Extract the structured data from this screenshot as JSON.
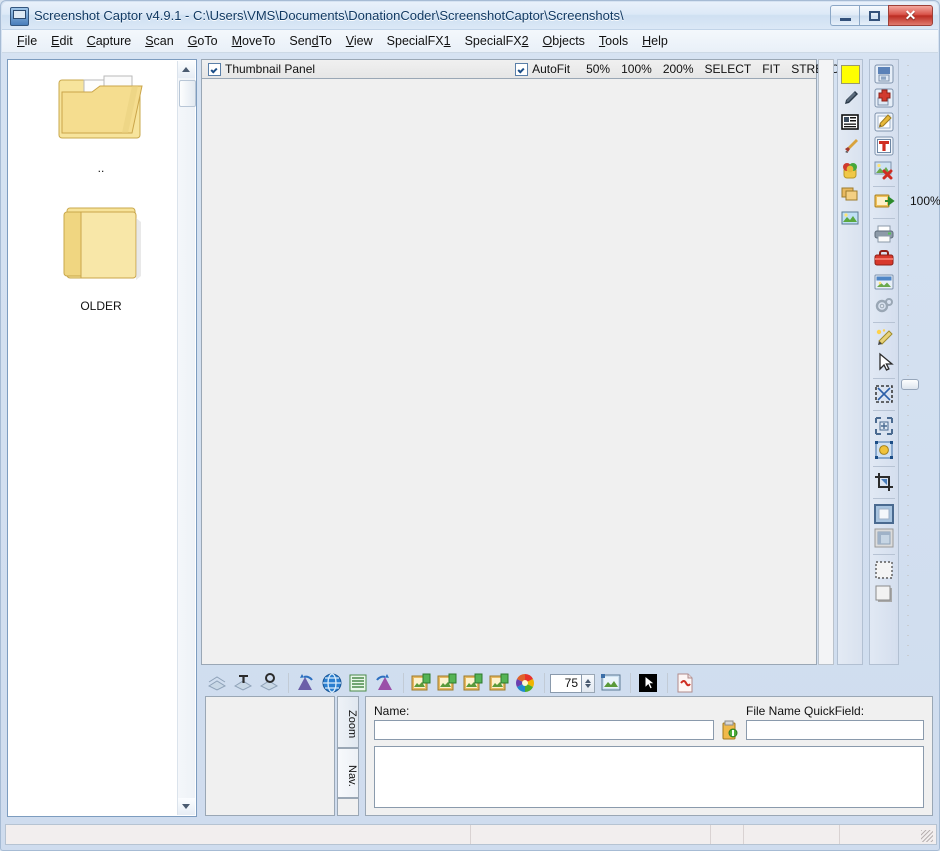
{
  "window": {
    "title": "Screenshot Captor v4.9.1 - C:\\Users\\VMS\\Documents\\DonationCoder\\ScreenshotCaptor\\Screenshots\\",
    "app_icon": "screenshot-captor-icon",
    "controls": {
      "minimize": "Minimize",
      "maximize": "Maximize",
      "close": "Close"
    }
  },
  "menubar": {
    "items": [
      {
        "label": "File",
        "accel": "F"
      },
      {
        "label": "Edit",
        "accel": "E"
      },
      {
        "label": "Capture",
        "accel": "C"
      },
      {
        "label": "Scan",
        "accel": "S"
      },
      {
        "label": "GoTo",
        "accel": "G"
      },
      {
        "label": "MoveTo",
        "accel": "M"
      },
      {
        "label": "SendTo",
        "accel": "d"
      },
      {
        "label": "View",
        "accel": "V"
      },
      {
        "label": "SpecialFX1",
        "accel": "1"
      },
      {
        "label": "SpecialFX2",
        "accel": "2"
      },
      {
        "label": "Objects",
        "accel": "O"
      },
      {
        "label": "Tools",
        "accel": "T"
      },
      {
        "label": "Help",
        "accel": "H"
      }
    ]
  },
  "file_browser": {
    "items": [
      {
        "icon": "parent-folder-icon",
        "label": ".."
      },
      {
        "icon": "folder-icon",
        "label": "OLDER"
      }
    ],
    "scrollbar": {
      "up": "scroll-up-arrow",
      "down": "scroll-down-arrow"
    }
  },
  "editor_header": {
    "thumbnail_panel": {
      "label": "Thumbnail Panel",
      "checked": true
    },
    "autofit": {
      "label": "AutoFit",
      "checked": true
    },
    "zoom_options": [
      "50%",
      "100%",
      "200%",
      "SELECT",
      "FIT",
      "STRETCH"
    ]
  },
  "zoom_slider": {
    "value_label": "100%"
  },
  "palette_strip": {
    "buttons": [
      {
        "name": "color-swatch-yellow",
        "color": "#ffff00"
      },
      {
        "name": "eyedropper-tool"
      },
      {
        "name": "text-block-tool"
      },
      {
        "name": "paintbrush-tool"
      },
      {
        "name": "fill-bucket-tool"
      },
      {
        "name": "copy-images-tool"
      },
      {
        "name": "image-preview-tool"
      }
    ]
  },
  "tool_column": {
    "buttons": [
      {
        "name": "save-icon"
      },
      {
        "name": "save-as-new-icon"
      },
      {
        "name": "edit-in-external-editor-icon"
      },
      {
        "name": "add-text-icon"
      },
      {
        "name": "delete-image-icon"
      },
      {
        "name": "export-image-icon"
      },
      {
        "name": "print-icon"
      },
      {
        "name": "toolbox-icon"
      },
      {
        "name": "slideshow-icon"
      },
      {
        "name": "settings-icon"
      },
      {
        "name": "special-effects-icon"
      },
      {
        "name": "pointer-select-icon"
      },
      {
        "name": "shrink-selection-icon"
      },
      {
        "name": "expand-canvas-icon"
      },
      {
        "name": "object-handles-icon"
      },
      {
        "name": "crop-icon"
      },
      {
        "name": "border-style-icon"
      },
      {
        "name": "inner-shadow-icon"
      },
      {
        "name": "dotted-border-icon"
      },
      {
        "name": "drop-shadow-icon"
      }
    ]
  },
  "editor_toolbar": {
    "buttons": [
      {
        "name": "flatten-image-icon"
      },
      {
        "name": "flatten-text-icon"
      },
      {
        "name": "flatten-objects-icon"
      },
      {
        "name": "rotate-left-icon"
      },
      {
        "name": "globe-web-icon"
      },
      {
        "name": "lines-list-icon"
      },
      {
        "name": "rotate-right-icon"
      },
      {
        "name": "resize-image-1-icon"
      },
      {
        "name": "resize-image-2-icon"
      },
      {
        "name": "resize-image-3-icon"
      },
      {
        "name": "resize-image-4-icon"
      },
      {
        "name": "color-wheel-icon"
      }
    ],
    "quality": {
      "value": "75",
      "spinner": "quality-spinner"
    },
    "trailing_buttons": [
      {
        "name": "thumbnail-preview-icon"
      },
      {
        "name": "cursor-capture-icon"
      },
      {
        "name": "export-pdf-icon"
      }
    ]
  },
  "bottom_panel": {
    "preview": {
      "name": "preview-thumbnail"
    },
    "tabs": [
      {
        "label": "Zoom",
        "selected": false
      },
      {
        "label": "Nav.",
        "selected": true
      }
    ],
    "name_field": {
      "label": "Name:",
      "value": "",
      "placeholder": ""
    },
    "name_field_button": {
      "name": "rename-lock-icon"
    },
    "quickfield": {
      "label": "File Name QuickField:",
      "value": "",
      "placeholder": ""
    },
    "notes_field": {
      "value": "",
      "placeholder": ""
    }
  },
  "statusbar": {
    "panes": [
      "",
      "",
      "",
      "",
      ""
    ]
  },
  "colors": {
    "accent": "#1c4e87",
    "title_text": "#123a63",
    "close_button": "#bb2c22",
    "canvas_bg": "#f0f0f0",
    "folder_yellow": "#f5dd8f"
  }
}
